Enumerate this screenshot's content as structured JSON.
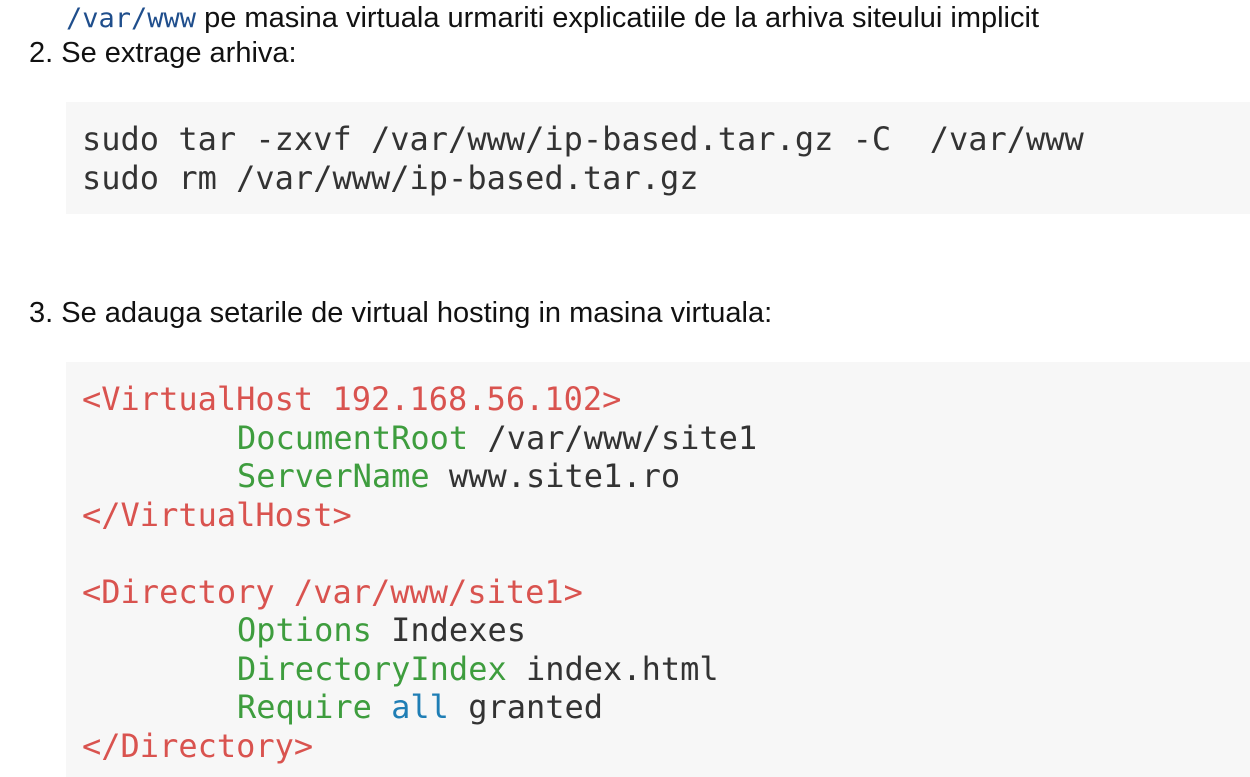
{
  "intro_line": {
    "code": "/var/www",
    "text": " pe masina virtuala urmariti explicatiile de la arhiva siteului implicit"
  },
  "steps": [
    {
      "number": "2.",
      "text": " Se extrage arhiva:"
    },
    {
      "number": "3.",
      "text": " Se adauga setarile de virtual hosting in masina virtuala:"
    }
  ],
  "code_block_1": {
    "lines": [
      "sudo tar -zxvf /var/www/ip-based.tar.gz -C  /var/www",
      "sudo rm /var/www/ip-based.tar.gz"
    ]
  },
  "code_block_2": {
    "vhost_open": "<VirtualHost 192.168.56.102>",
    "document_root_key": "DocumentRoot",
    "document_root_value": " /var/www/site1",
    "server_name_key": "ServerName",
    "server_name_value": " www.site1.ro",
    "vhost_close": "</VirtualHost>",
    "dir_open": "<Directory /var/www/site1>",
    "options_key": "Options",
    "options_value": " Indexes",
    "dirindex_key": "DirectoryIndex",
    "dirindex_value": " index.html",
    "require_key": "Require",
    "require_all": " all",
    "require_value": " granted",
    "dir_close": "</Directory>"
  },
  "colors": {
    "tag": "#d9534f",
    "directive": "#3e9d3e",
    "keyword": "#1f7eb5",
    "inline_code": "#1f4e8c",
    "code_background": "#f7f7f7"
  }
}
